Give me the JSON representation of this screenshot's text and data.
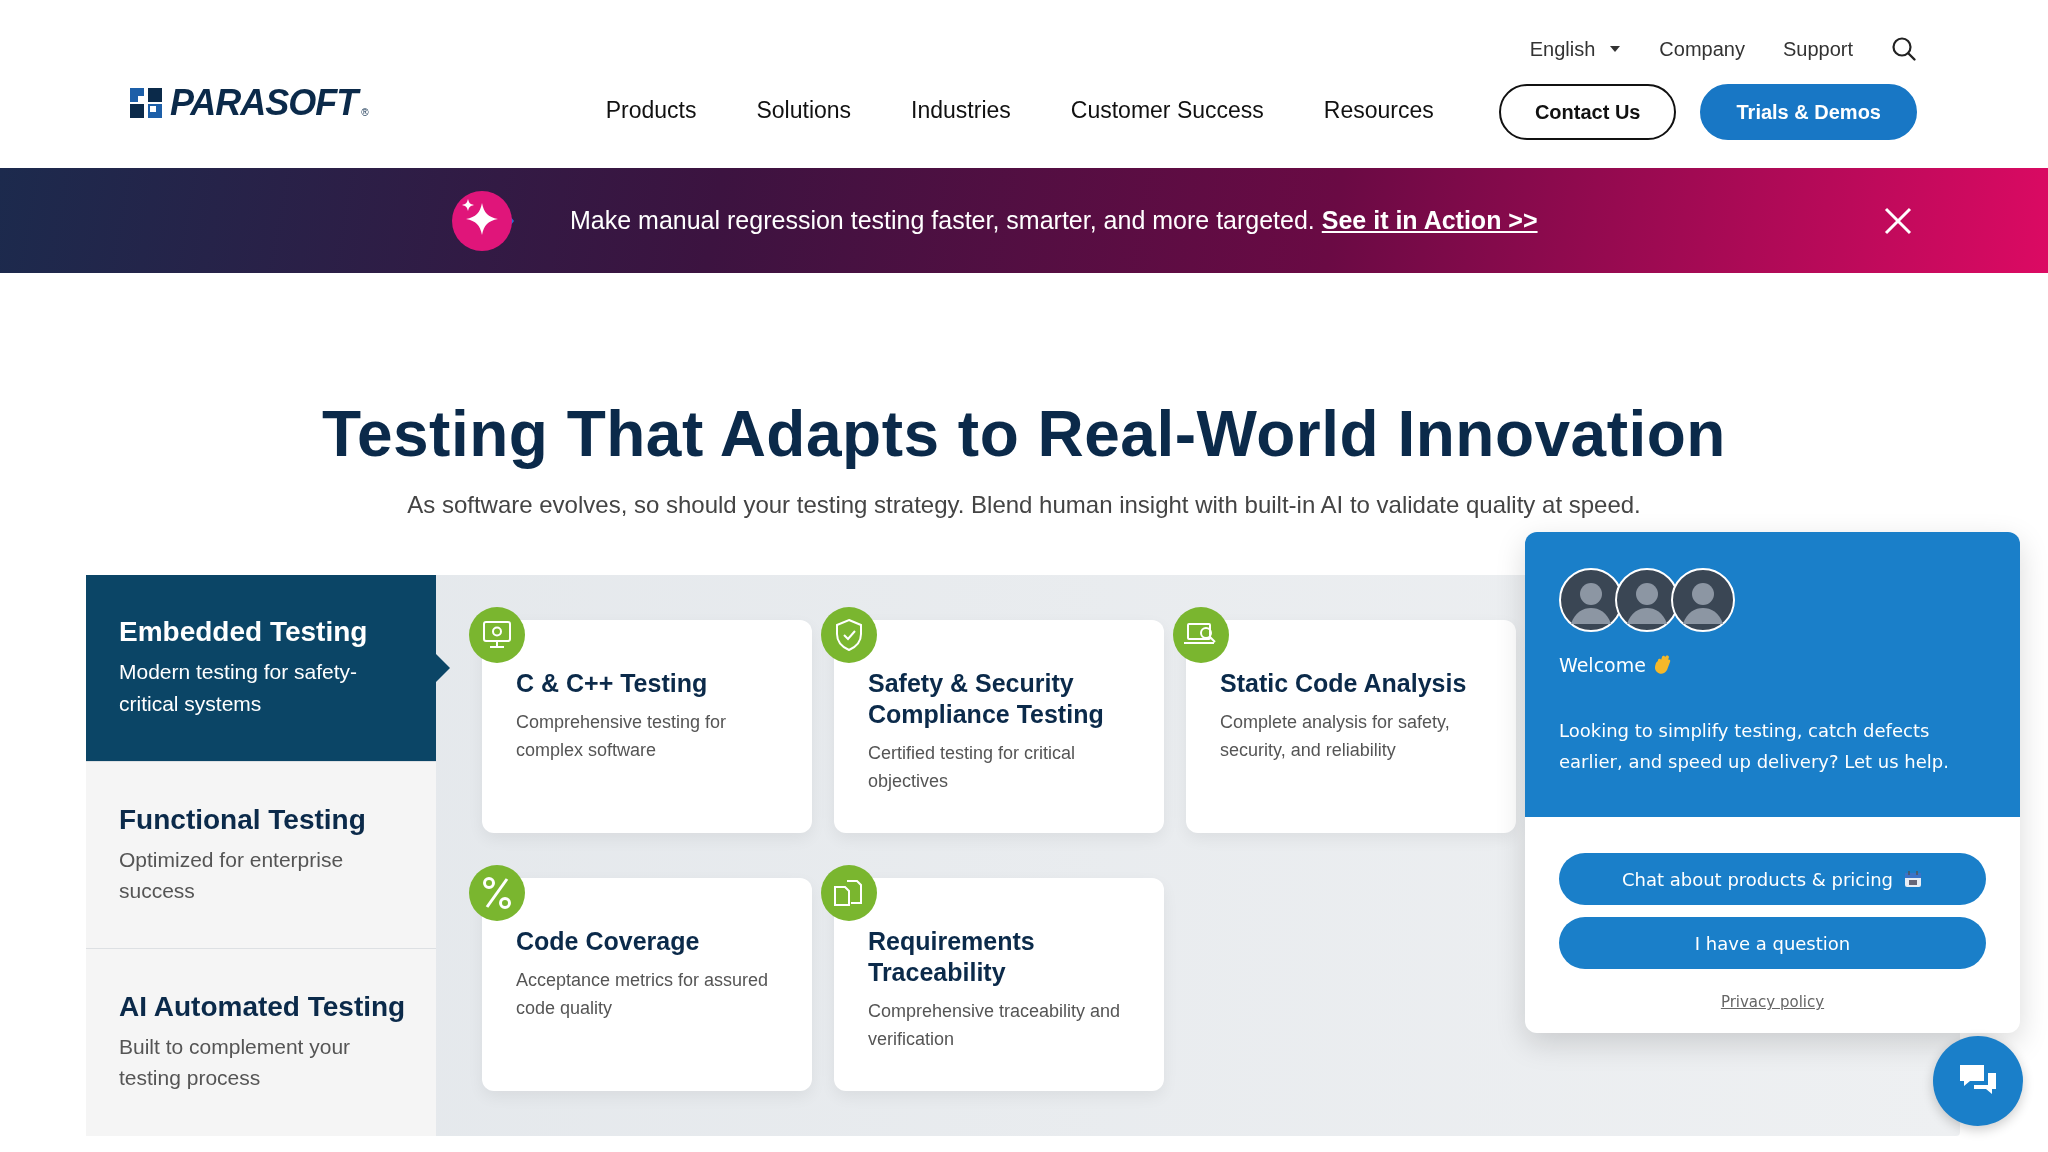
{
  "header": {
    "logo": {
      "name": "PARASOFT",
      "mark": "®"
    },
    "utility_links": [
      {
        "label": "English",
        "kind": "dropdown"
      },
      {
        "label": "Company",
        "kind": "link"
      },
      {
        "label": "Support",
        "kind": "link"
      }
    ],
    "nav": [
      "Products",
      "Solutions",
      "Industries",
      "Customer Success",
      "Resources"
    ],
    "buttons": [
      {
        "label": "Contact Us",
        "kind": "outline"
      },
      {
        "label": "Trials & Demos",
        "kind": "filled"
      }
    ]
  },
  "banner": {
    "text": "Make manual regression testing faster, smarter, and more targeted.",
    "link": "See it in Action >>"
  },
  "hero": {
    "title": "Testing That Adapts to Real-World Innovation",
    "subtitle": "As software evolves, so should your testing strategy. Blend human insight with built-in AI to validate quality at speed."
  },
  "tabs": [
    {
      "title": "Embedded Testing",
      "subtitle": "Modern testing for safety-critical systems",
      "selected": true
    },
    {
      "title": "Functional Testing",
      "subtitle": "Optimized for enterprise success",
      "selected": false
    },
    {
      "title": "AI Automated Testing",
      "subtitle": "Built to complement your testing process",
      "selected": false
    }
  ],
  "cards": [
    {
      "title": "C & C++ Testing",
      "description": "Comprehensive testing for complex software",
      "kind": "monitor"
    },
    {
      "title": "Safety & Security Compliance Testing",
      "description": "Certified testing for critical objectives",
      "kind": "shield"
    },
    {
      "title": "Static Code Analysis",
      "description": "Complete analysis for safety, security, and reliability",
      "kind": "laptop"
    },
    {
      "title": "Code Coverage",
      "description": "Acceptance metrics for assured code quality",
      "kind": "percent"
    },
    {
      "title": "Requirements Traceability",
      "description": "Comprehensive traceability and verification",
      "kind": "documents"
    }
  ],
  "chat": {
    "welcome": "Welcome",
    "message": "Looking to simplify testing, catch defects earlier, and speed up delivery? Let us help.",
    "actions": [
      {
        "label": "Chat about products & pricing",
        "kind": "calendar"
      },
      {
        "label": "I have a question",
        "kind": "plain"
      }
    ],
    "privacy": "Privacy policy"
  }
}
